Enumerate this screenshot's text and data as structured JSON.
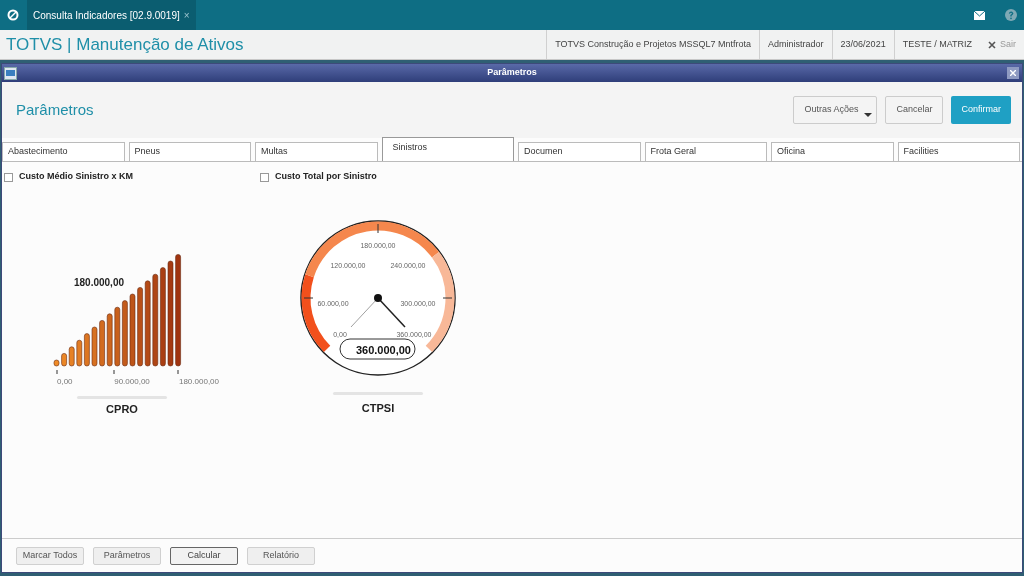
{
  "app_tab": {
    "label": "Consulta Indicadores [02.9.0019]",
    "close": "×"
  },
  "header": {
    "title": "TOTVS | Manutenção de Ativos",
    "info": [
      "TOTVS Construção e Projetos MSSQL7 Mntfrota",
      "Administrador",
      "23/06/2021",
      "TESTE / MATRIZ"
    ],
    "exit": "Sair"
  },
  "dialog": {
    "title": "Parâmetros",
    "heading": "Parâmetros",
    "actions": [
      {
        "label": "Outras Ações",
        "kind": "menu"
      },
      {
        "label": "Cancelar",
        "kind": "plain"
      },
      {
        "label": "Confirmar",
        "kind": "primary"
      }
    ]
  },
  "tabs": [
    {
      "label": "Abastecimento",
      "selected": false
    },
    {
      "label": "Pneus",
      "selected": false
    },
    {
      "label": "Multas",
      "selected": false
    },
    {
      "label": "Sinistros",
      "selected": true
    },
    {
      "label": "Documen",
      "selected": false
    },
    {
      "label": "Frota Geral",
      "selected": false
    },
    {
      "label": "Oficina",
      "selected": false
    },
    {
      "label": "Facilities",
      "selected": false
    }
  ],
  "indicators": [
    {
      "label": "Custo Médio Sinistro x KM",
      "checked": false,
      "kind": "bars",
      "value": "180.000,00",
      "ticks": [
        "0,00",
        "90.000,00",
        "180.000,00"
      ],
      "name": "CPRO"
    },
    {
      "label": "Custo Total por Sinistro",
      "checked": false,
      "kind": "gauge",
      "value": "360.000,00",
      "ticks": [
        "180.000,00",
        "120.000,00",
        "240.000,00",
        "60.000,00",
        "300.000,00",
        "0,00",
        "360.000,00"
      ],
      "name": "CTPSI"
    }
  ],
  "footer_buttons": [
    {
      "label": "Marcar Todos",
      "selected": false
    },
    {
      "label": "Parâmetros",
      "selected": false
    },
    {
      "label": "Calcular",
      "selected": true
    },
    {
      "label": "Relatório",
      "selected": false
    }
  ]
}
